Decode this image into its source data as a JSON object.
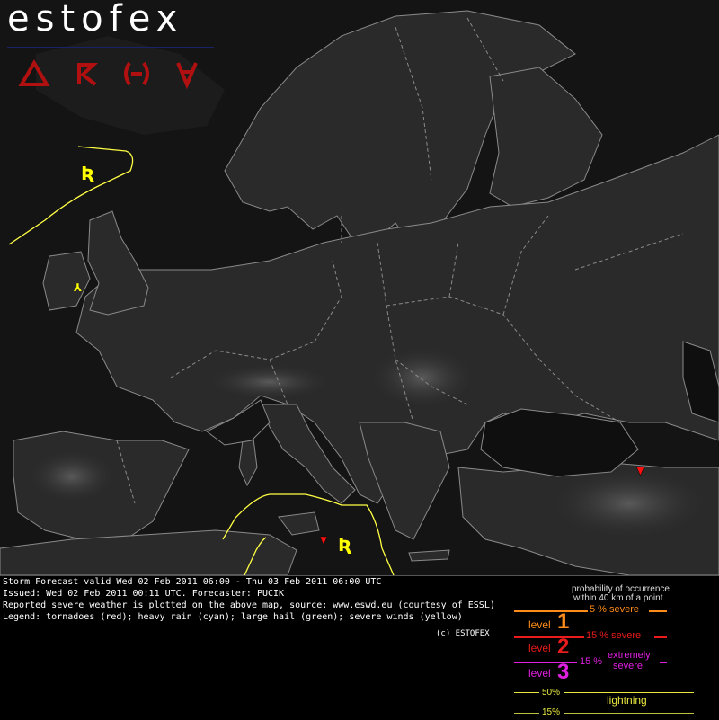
{
  "brand": {
    "name": "estofex"
  },
  "symbols": [
    {
      "name": "tornado-symbol-icon",
      "color": "#b01010"
    },
    {
      "name": "hail-symbol-icon",
      "color": "#b01010"
    },
    {
      "name": "rain-symbol-icon",
      "color": "#b01010"
    },
    {
      "name": "wind-symbol-icon",
      "color": "#b01010"
    }
  ],
  "map": {
    "threat_symbol_color": "#ffff00",
    "lightning_line_color": "#ffff44",
    "report_marker_color": "#ff1010",
    "border_color": "#8a8a8a"
  },
  "footer": {
    "valid": "Storm Forecast valid Wed 02 Feb 2011 06:00 - Thu 03 Feb 2011 06:00 UTC",
    "issued": "Issued: Wed 02 Feb 2011 00:11 UTC. Forecaster: PUCIK",
    "reported": "Reported severe weather is plotted on the above map, source: www.eswd.eu (courtesy of ESSL)",
    "legend": "Legend: tornadoes (red); heavy rain (cyan); large hail (green); severe winds (yellow)",
    "copyright": "(c) ESTOFEX"
  },
  "legend": {
    "title_line1": "probability of occurrence",
    "title_line2": "within 40 km of a point",
    "l1_prob": "5 % severe",
    "level_word": "level",
    "l1_num": "1",
    "l2_prob": "15 % severe",
    "l2_num": "2",
    "l3_prob": "15 %",
    "l3_extreme1": "extremely",
    "l3_extreme2": "severe",
    "l3_num": "3",
    "lightning_50": "50%",
    "lightning_label": "lightning",
    "lightning_15": "15%",
    "colors": {
      "level1": "#ff8c1a",
      "level2": "#e81c1c",
      "level3": "#e020e0",
      "lightning": "#e8e840"
    }
  }
}
